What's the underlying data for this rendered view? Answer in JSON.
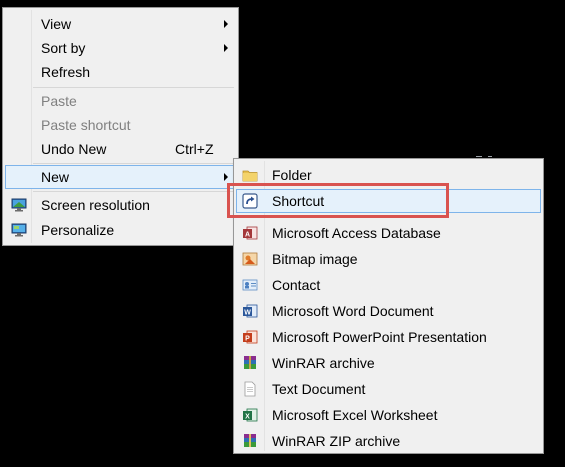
{
  "context_menu": {
    "items": [
      {
        "label": "View",
        "has_submenu": true
      },
      {
        "label": "Sort by",
        "has_submenu": true
      },
      {
        "label": "Refresh"
      },
      {
        "label": "Paste",
        "disabled": true
      },
      {
        "label": "Paste shortcut",
        "disabled": true
      },
      {
        "label": "Undo New",
        "shortcut": "Ctrl+Z"
      },
      {
        "label": "New",
        "has_submenu": true,
        "highlighted": true
      },
      {
        "label": "Screen resolution",
        "icon": "screen-resolution-icon"
      },
      {
        "label": "Personalize",
        "icon": "personalize-icon"
      }
    ]
  },
  "new_submenu": {
    "items": [
      {
        "label": "Folder",
        "icon": "folder-icon"
      },
      {
        "label": "Shortcut",
        "icon": "shortcut-icon",
        "highlighted": true
      },
      {
        "label": "Microsoft Access Database",
        "icon": "access-icon"
      },
      {
        "label": "Bitmap image",
        "icon": "bitmap-icon"
      },
      {
        "label": "Contact",
        "icon": "contact-icon"
      },
      {
        "label": "Microsoft Word Document",
        "icon": "word-icon"
      },
      {
        "label": "Microsoft PowerPoint Presentation",
        "icon": "powerpoint-icon"
      },
      {
        "label": "WinRAR archive",
        "icon": "winrar-icon"
      },
      {
        "label": "Text Document",
        "icon": "text-document-icon"
      },
      {
        "label": "Microsoft Excel Worksheet",
        "icon": "excel-icon"
      },
      {
        "label": "WinRAR ZIP archive",
        "icon": "winrar-zip-icon"
      }
    ]
  },
  "colors": {
    "menu_bg": "#f0f0f0",
    "highlight_bg": "#e5f1fb",
    "highlight_border": "#7eb4ea",
    "annotation": "#d9534f",
    "desktop": "#000000"
  }
}
